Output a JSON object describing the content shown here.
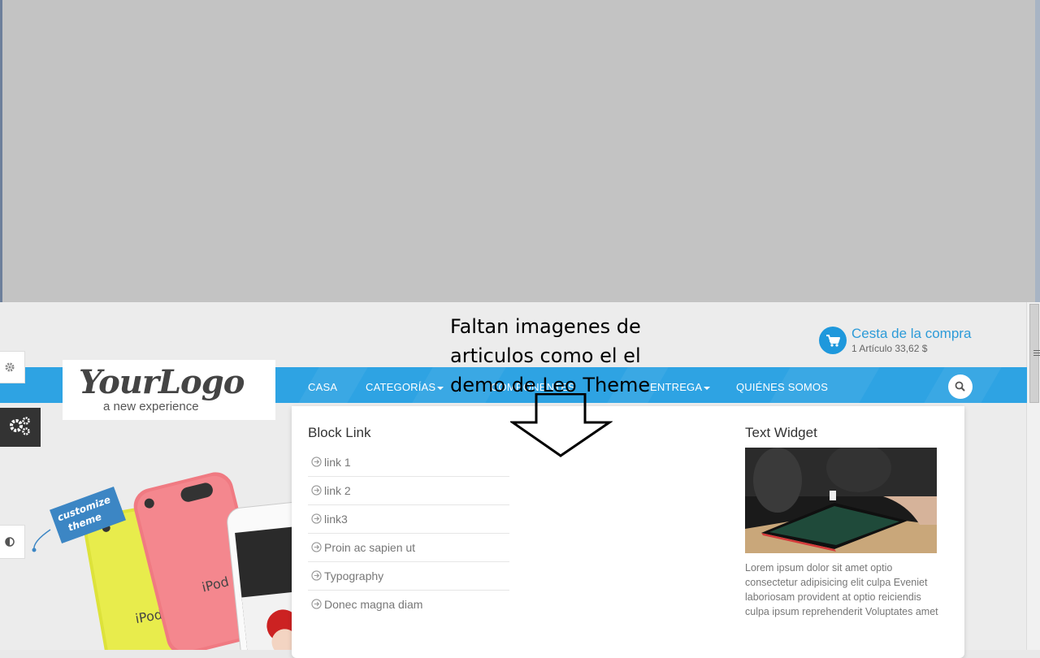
{
  "annotation": {
    "text": "Faltan imagenes de articulos como el el demo de Leo Theme"
  },
  "logo": {
    "main": "YourLogo",
    "tagline": "a new experience"
  },
  "cart": {
    "icon": "cart-icon",
    "title": "Cesta de la compra",
    "summary": "1 Artículo 33,62 $"
  },
  "nav": {
    "items": [
      {
        "label": "CASA",
        "has_dropdown": false
      },
      {
        "label": "CATEGORÍAS",
        "has_dropdown": true
      },
      {
        "label": "COMPONENTES",
        "has_dropdown": false
      },
      {
        "label": "ENTREGA",
        "has_dropdown": true
      },
      {
        "label": "QUIÉNES SOMOS",
        "has_dropdown": false
      }
    ],
    "search_icon": "search-icon"
  },
  "hero": {
    "badge_line1": "customize",
    "badge_line2": "theme",
    "device_labels": [
      "iPod",
      "iPod"
    ]
  },
  "dropdown": {
    "block_link_title": "Block Link",
    "links": [
      "link 1",
      "link 2",
      "link3",
      "Proin ac sapien ut",
      "Typography",
      "Donec magna diam"
    ],
    "text_widget_title": "Text Widget",
    "text_widget_body": "Lorem ipsum dolor sit amet optio consectetur adipisicing elit culpa Eveniet laboriosam provident at optio reiciendis culpa ipsum reprehenderit Voluptates amet"
  },
  "colors": {
    "nav_blue": "#2ea3e3",
    "cart_blue": "#1e98dc",
    "placeholder_gray": "#c3c3c3"
  }
}
